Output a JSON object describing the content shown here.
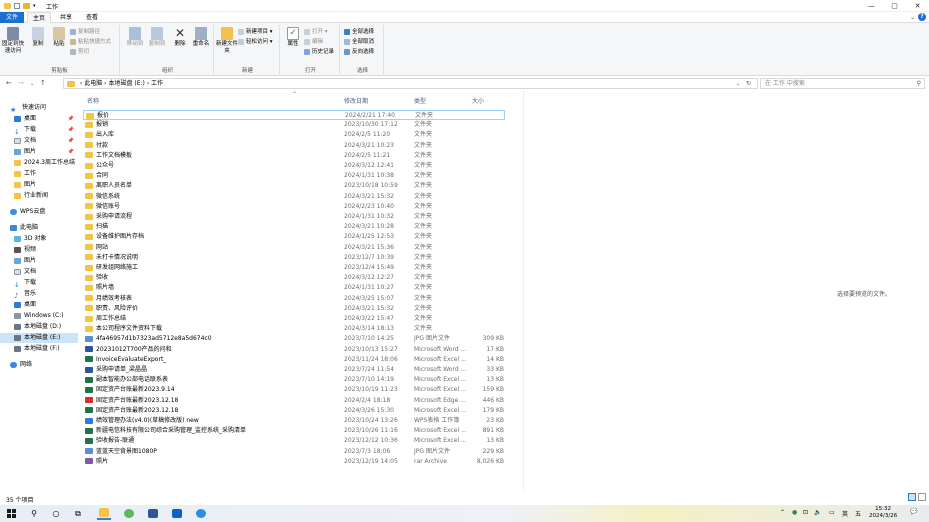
{
  "window": {
    "title": "工作",
    "minimize": "—",
    "maximize": "▢",
    "close": "✕"
  },
  "tabs": [
    {
      "label": "文件"
    },
    {
      "label": "主页"
    },
    {
      "label": "共享"
    },
    {
      "label": "查看"
    }
  ],
  "ribbon": {
    "clipboard": {
      "label": "剪贴板",
      "pin": "固定到快速访问",
      "copy": "复制",
      "paste": "粘贴",
      "copy_path": "复制路径",
      "paste_shortcut": "粘贴快捷方式",
      "cut": "剪切"
    },
    "organize": {
      "label": "组织",
      "move_to": "移动到",
      "copy_to": "复制到",
      "delete": "删除",
      "rename": "重命名"
    },
    "new": {
      "label": "新建",
      "new_folder": "新建文件夹",
      "new_item": "新建项目 ▾",
      "easy_access": "轻松访问 ▾"
    },
    "open": {
      "label": "打开",
      "properties": "属性",
      "open": "打开 ▾",
      "edit": "编辑",
      "history": "历史记录"
    },
    "select": {
      "label": "选择",
      "select_all": "全部选择",
      "select_none": "全部取消",
      "invert": "反向选择"
    }
  },
  "address": {
    "path": "›  此电脑  ›  本地磁盘 (E:)  ›  工作",
    "search_placeholder": "在 工作 中搜索"
  },
  "nav": {
    "quick_access": "快速访问",
    "quick_items": [
      "桌面",
      "下载",
      "文档",
      "图片",
      "2024.3周工作总结",
      "工作",
      "图片",
      "行业新闻"
    ],
    "wps": "WPS云盘",
    "this_pc": "此电脑",
    "pc_items": [
      "3D 对象",
      "视频",
      "图片",
      "文档",
      "下载",
      "音乐",
      "桌面",
      "Windows (C:)",
      "本地磁盘 (D:)",
      "本地磁盘 (E:)",
      "本地磁盘 (F:)"
    ],
    "network": "网络"
  },
  "columns": {
    "name": "名称",
    "date": "修改日期",
    "type": "类型",
    "size": "大小"
  },
  "files": [
    {
      "name": "报价",
      "date": "2024/2/21 17:40",
      "type": "文件夹",
      "size": "",
      "icon": "folder"
    },
    {
      "name": "报销",
      "date": "2023/10/30 17:12",
      "type": "文件夹",
      "size": "",
      "icon": "folder"
    },
    {
      "name": "出入库",
      "date": "2024/2/5 11:20",
      "type": "文件夹",
      "size": "",
      "icon": "folder"
    },
    {
      "name": "付款",
      "date": "2024/3/21 10:23",
      "type": "文件夹",
      "size": "",
      "icon": "folder"
    },
    {
      "name": "工作文档模板",
      "date": "2024/2/5 11:21",
      "type": "文件夹",
      "size": "",
      "icon": "folder"
    },
    {
      "name": "公众号",
      "date": "2024/3/12 12:41",
      "type": "文件夹",
      "size": "",
      "icon": "folder"
    },
    {
      "name": "合同",
      "date": "2024/1/31 10:38",
      "type": "文件夹",
      "size": "",
      "icon": "folder"
    },
    {
      "name": "离职人员名单",
      "date": "2023/10/18 10:59",
      "type": "文件夹",
      "size": "",
      "icon": "folder"
    },
    {
      "name": "微信系统",
      "date": "2024/3/21 15:32",
      "type": "文件夹",
      "size": "",
      "icon": "folder"
    },
    {
      "name": "微信账号",
      "date": "2024/2/23 10:40",
      "type": "文件夹",
      "size": "",
      "icon": "folder"
    },
    {
      "name": "采购申请流程",
      "date": "2024/1/31 10:32",
      "type": "文件夹",
      "size": "",
      "icon": "folder"
    },
    {
      "name": "扫描",
      "date": "2024/3/21 10:28",
      "type": "文件夹",
      "size": "",
      "icon": "folder"
    },
    {
      "name": "设备维护图片存档",
      "date": "2024/1/25 12:53",
      "type": "文件夹",
      "size": "",
      "icon": "folder"
    },
    {
      "name": "网站",
      "date": "2024/3/21 15:36",
      "type": "文件夹",
      "size": "",
      "icon": "folder"
    },
    {
      "name": "未打卡情况说明",
      "date": "2023/12/7 10:39",
      "type": "文件夹",
      "size": "",
      "icon": "folder"
    },
    {
      "name": "研发组网络施工",
      "date": "2023/12/4 15:49",
      "type": "文件夹",
      "size": "",
      "icon": "folder"
    },
    {
      "name": "验收",
      "date": "2024/3/12 12:27",
      "type": "文件夹",
      "size": "",
      "icon": "folder"
    },
    {
      "name": "照片墙",
      "date": "2024/1/31 10:27",
      "type": "文件夹",
      "size": "",
      "icon": "folder"
    },
    {
      "name": "月绩效考核表",
      "date": "2024/3/25 15:07",
      "type": "文件夹",
      "size": "",
      "icon": "folder"
    },
    {
      "name": "职责、风险评价",
      "date": "2024/3/21 15:32",
      "type": "文件夹",
      "size": "",
      "icon": "folder"
    },
    {
      "name": "周工作总结",
      "date": "2024/3/22 15:47",
      "type": "文件夹",
      "size": "",
      "icon": "folder"
    },
    {
      "name": "本公司程序文件资料下载",
      "date": "2024/3/14 18:13",
      "type": "文件夹",
      "size": "",
      "icon": "folder"
    },
    {
      "name": "4fa46957d1b7323ad5712e8a5d674c0",
      "date": "2023/7/10 14:25",
      "type": "JPG 图片文件",
      "size": "309 KB",
      "icon": "jpg"
    },
    {
      "name": "20231012T700产品的问和",
      "date": "2023/10/13 15:27",
      "type": "Microsoft Word ...",
      "size": "17 KB",
      "icon": "word"
    },
    {
      "name": "InvoiceEvaluateExport_",
      "date": "2023/11/24 18:06",
      "type": "Microsoft Excel ...",
      "size": "14 KB",
      "icon": "excel"
    },
    {
      "name": "采购申请单_梁晶晶",
      "date": "2023/7/24 11:54",
      "type": "Microsoft Word ...",
      "size": "33 KB",
      "icon": "word"
    },
    {
      "name": "副本智能办公部电话联系表",
      "date": "2023/7/10 14:19",
      "type": "Microsoft Excel ...",
      "size": "13 KB",
      "icon": "excel"
    },
    {
      "name": "固定资产台账最新2023.9.14",
      "date": "2023/10/19 11:23",
      "type": "Microsoft Excel ...",
      "size": "159 KB",
      "icon": "excel"
    },
    {
      "name": "固定资产台账最新2023.12.18",
      "date": "2024/2/4 18:18",
      "type": "Microsoft Edge ...",
      "size": "446 KB",
      "icon": "pdf"
    },
    {
      "name": "固定资产台账最新2023.12.18",
      "date": "2024/3/26 15:30",
      "type": "Microsoft Excel ...",
      "size": "179 KB",
      "icon": "excel"
    },
    {
      "name": "绩效管理办法(v4.0)(草稿修改版) new",
      "date": "2023/10/24 13:26",
      "type": "WPS表格 工作簿",
      "size": "23 KB",
      "icon": "wps"
    },
    {
      "name": "新疆电信科技有限公司综合采购管理_监控系统_采购清单",
      "date": "2023/10/26 11:16",
      "type": "Microsoft Excel ...",
      "size": "891 KB",
      "icon": "excel"
    },
    {
      "name": "验收报告-联通",
      "date": "2023/12/12 10:36",
      "type": "Microsoft Excel ...",
      "size": "13 KB",
      "icon": "excel"
    },
    {
      "name": "蓝蓝天空背景图1080P",
      "date": "2023/7/3 18:06",
      "type": "JPG 图片文件",
      "size": "229 KB",
      "icon": "jpg"
    },
    {
      "name": "照片",
      "date": "2023/12/19 14:05",
      "type": "rar Archive",
      "size": "8,026 KB",
      "icon": "rar"
    }
  ],
  "preview": {
    "message": "选择要预览的文件。"
  },
  "status": {
    "count": "35 个项目"
  },
  "taskbar": {
    "tray_text": "英",
    "ime": "五",
    "time": "15:32",
    "date": "2024/3/26"
  }
}
